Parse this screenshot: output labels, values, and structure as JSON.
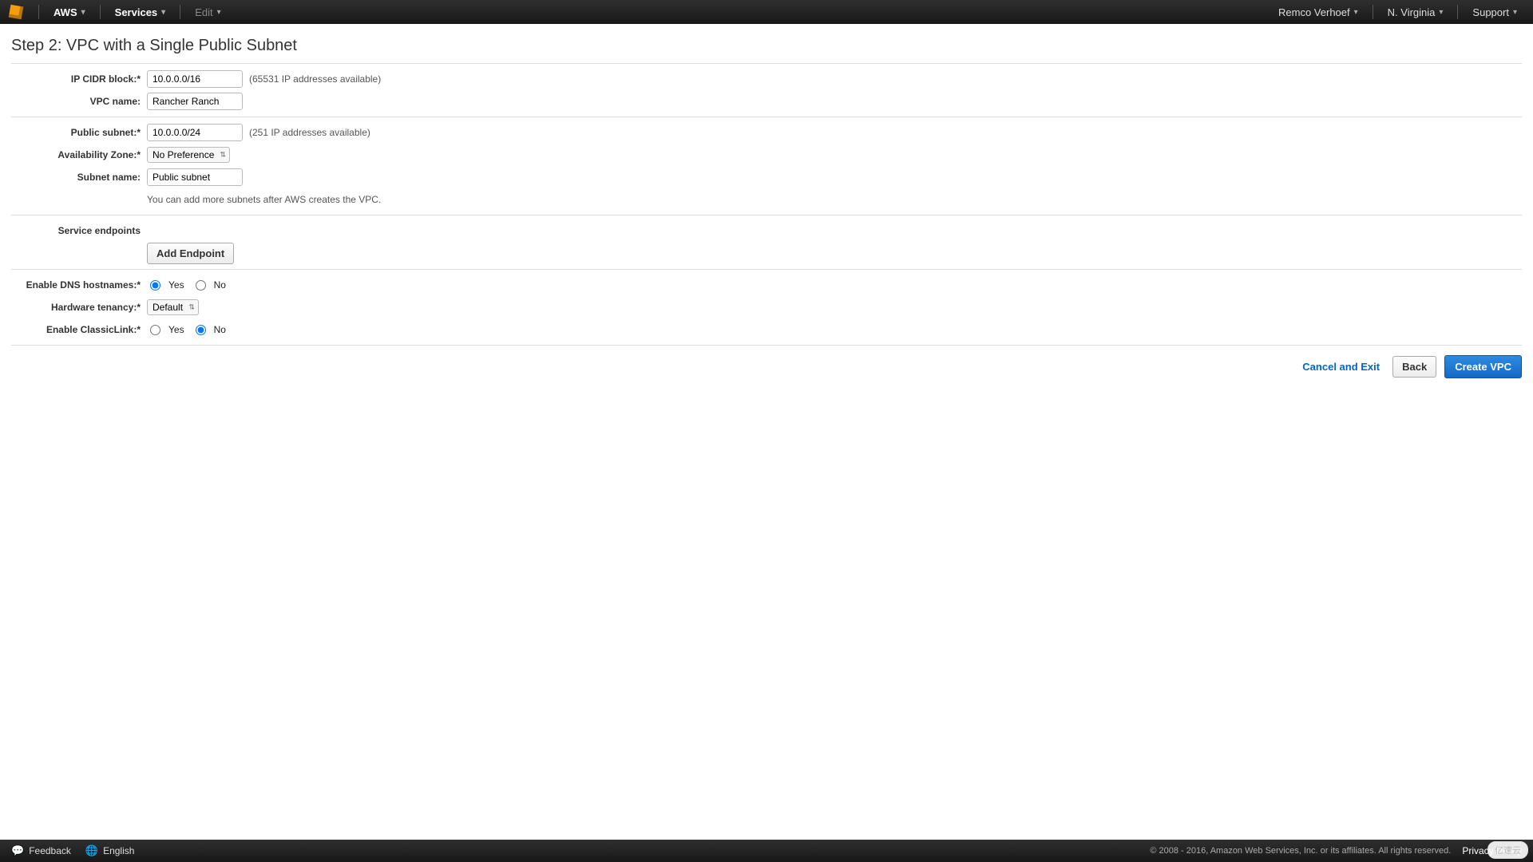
{
  "topbar": {
    "aws": "AWS",
    "services": "Services",
    "edit": "Edit",
    "user": "Remco Verhoef",
    "region": "N. Virginia",
    "support": "Support"
  },
  "header": {
    "title": "Step 2: VPC with a Single Public Subnet"
  },
  "form": {
    "cidr_label": "IP CIDR block:*",
    "cidr_value": "10.0.0.0/16",
    "cidr_hint": "(65531 IP addresses available)",
    "vpcname_label": "VPC name:",
    "vpcname_value": "Rancher Ranch",
    "pubsubnet_label": "Public subnet:*",
    "pubsubnet_value": "10.0.0.0/24",
    "pubsubnet_hint": "(251 IP addresses available)",
    "az_label": "Availability Zone:*",
    "az_value": "No Preference",
    "subnetname_label": "Subnet name:",
    "subnetname_value": "Public subnet",
    "subnet_note": "You can add more subnets after AWS creates the VPC.",
    "endpoints_label": "Service endpoints",
    "add_endpoint": "Add Endpoint",
    "dns_label": "Enable DNS hostnames:*",
    "tenancy_label": "Hardware tenancy:*",
    "tenancy_value": "Default",
    "classic_label": "Enable ClassicLink:*",
    "radio_yes": "Yes",
    "radio_no": "No"
  },
  "actions": {
    "cancel": "Cancel and Exit",
    "back": "Back",
    "create": "Create VPC"
  },
  "footer": {
    "feedback": "Feedback",
    "language": "English",
    "copyright": "© 2008 - 2016, Amazon Web Services, Inc. or its affiliates. All rights reserved.",
    "privacy": "Privacy Policy"
  },
  "watermark": "亿速云"
}
